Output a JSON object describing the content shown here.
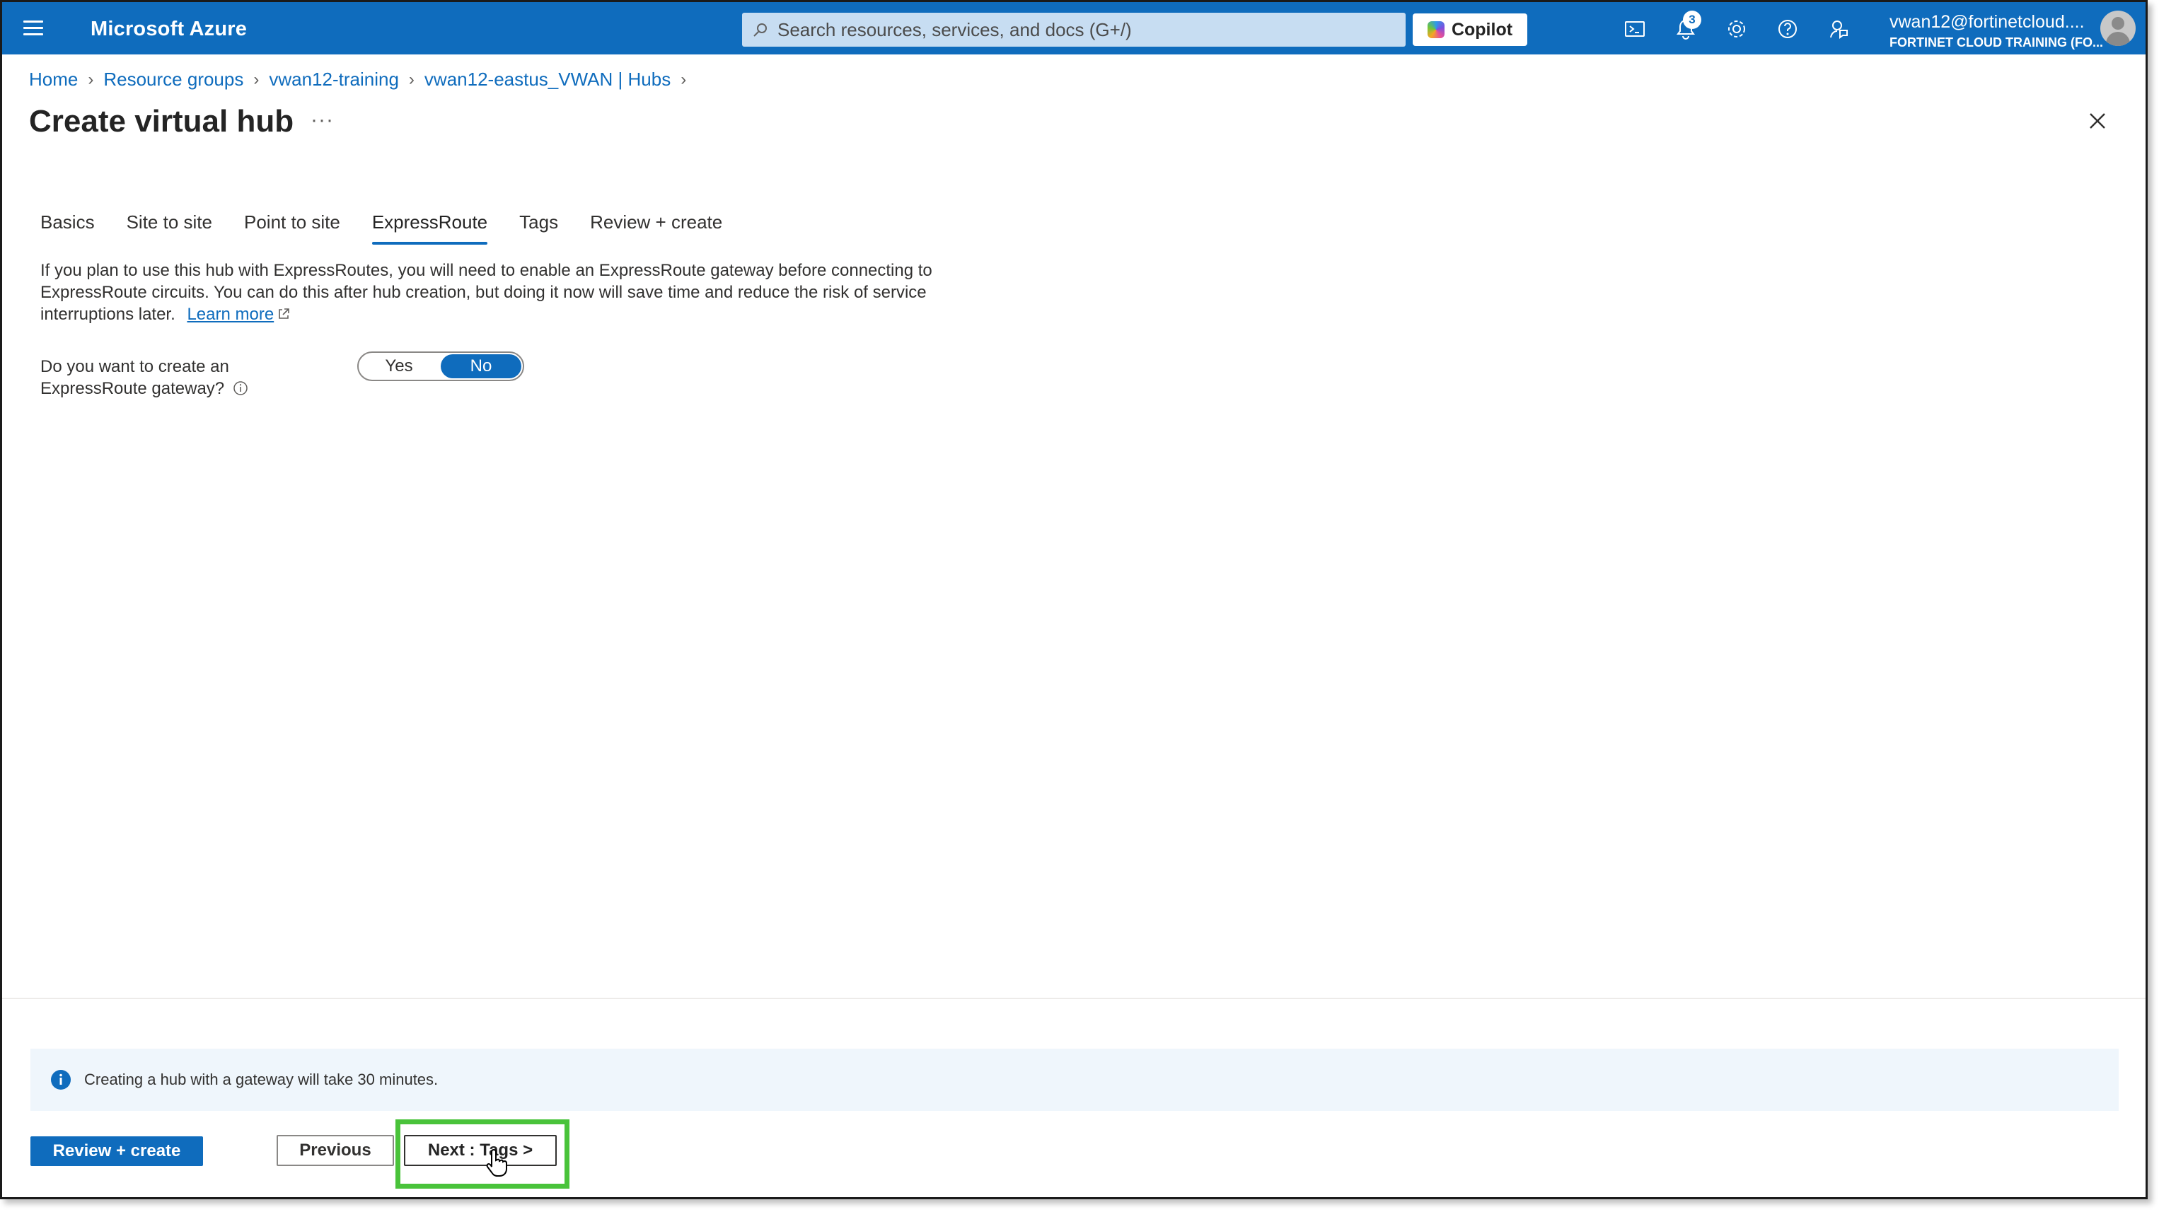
{
  "topbar": {
    "menu_icon": "hamburger-icon",
    "brand": "Microsoft Azure",
    "search_placeholder": "Search resources, services, and docs (G+/)",
    "copilot_label": "Copilot",
    "notification_count": "3",
    "icons": [
      "cloud-shell-icon",
      "bell-icon",
      "gear-icon",
      "help-icon",
      "feedback-icon"
    ],
    "account_email": "vwan12@fortinetcloud....",
    "account_tenant": "FORTINET CLOUD TRAINING (FO..."
  },
  "breadcrumb": [
    "Home",
    "Resource groups",
    "vwan12-training",
    "vwan12-eastus_VWAN | Hubs"
  ],
  "page": {
    "title": "Create virtual hub",
    "more": "···"
  },
  "tabs": [
    "Basics",
    "Site to site",
    "Point to site",
    "ExpressRoute",
    "Tags",
    "Review + create"
  ],
  "active_tab": "ExpressRoute",
  "content": {
    "description": "If you plan to use this hub with ExpressRoutes, you will need to enable an ExpressRoute gateway before connecting to ExpressRoute circuits. You can do this after hub creation, but doing it now will save time and reduce the risk of service interruptions later.",
    "learn_more": "Learn more",
    "question": "Do you want to create an ExpressRoute gateway?",
    "toggle_yes": "Yes",
    "toggle_no": "No",
    "toggle_selected": "No"
  },
  "footer": {
    "info_message": "Creating a hub with a gateway will take 30 minutes.",
    "review_create": "Review + create",
    "previous": "Previous",
    "next": "Next : Tags >"
  },
  "colors": {
    "accent": "#0f6cbd",
    "highlight": "#49c33a",
    "info_bg": "#eff6fc"
  }
}
